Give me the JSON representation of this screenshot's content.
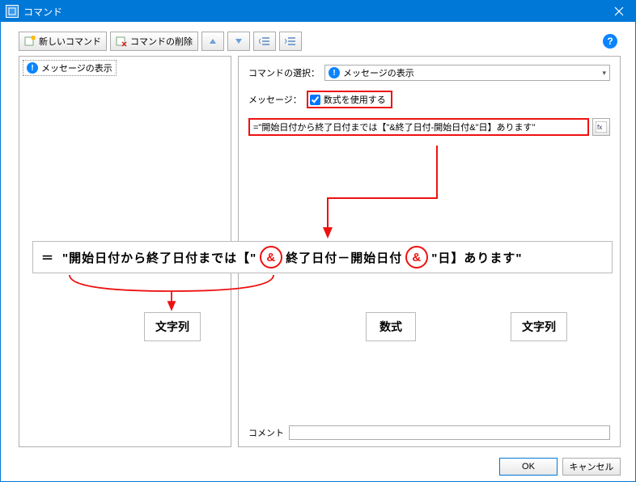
{
  "window": {
    "title": "コマンド"
  },
  "toolbar": {
    "new_command": "新しいコマンド",
    "delete_command": "コマンドの削除"
  },
  "tree": {
    "items": [
      {
        "label": "メッセージの表示"
      }
    ]
  },
  "right": {
    "command_select_label": "コマンドの選択：",
    "command_selected": "メッセージの表示",
    "message_label": "メッセージ：",
    "use_formula_label": "数式を使用する",
    "formula_value": "=\"開始日付から終了日付までは【\"&終了日付-開始日付&\"日】あります\"",
    "comment_label": "コメント",
    "comment_value": ""
  },
  "footer": {
    "ok": "OK",
    "cancel": "キャンセル"
  },
  "annotation": {
    "expr_parts": {
      "eq": "＝",
      "str1": "\"開始日付から終了日付までは【\"",
      "amp": "&",
      "calc": "終了日付－開始日付",
      "str2": "\"日】あります\""
    },
    "labels": {
      "string": "文字列",
      "formula": "数式"
    }
  }
}
